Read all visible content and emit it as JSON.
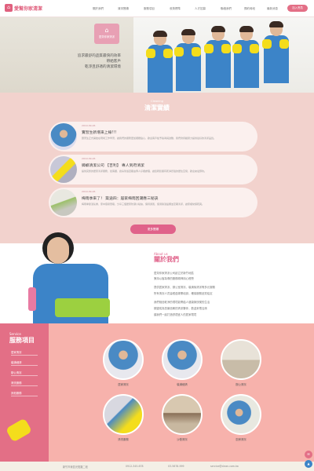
{
  "header": {
    "brand": "愛幫你家清潔",
    "nav": [
      "關於我們",
      "清潔實績",
      "服務項目",
      "收費標準",
      "人才招募",
      "聯絡我們",
      "預約時段",
      "最新消息"
    ],
    "login": "加入會員"
  },
  "hero": {
    "logo_text": "愛幫你家清潔",
    "lines": [
      "追求最舒的品質最快的效率",
      "帶給客戶",
      "乾淨且舒適的清潔環境"
    ]
  },
  "cleaning": {
    "subtitle": "Cleaning",
    "title": "清潔實績",
    "items": [
      {
        "date": "2019-09-26",
        "title": "實習生新增來上線!!!",
        "text": "實習生正式開始在現場工作學習，讓我們的服務更加細緻貼心，歡迎客戶給予指導與鼓勵，我們會持續努力提供最好的清潔品質。"
      },
      {
        "date": "2019-09-26",
        "title": "蟑螂清潔公司 【吉利】 專人到府清潔",
        "text": "提供完整的居家清潔服務，從客廳、廚房到浴室都由專人仔細處理，讓您輕鬆擁有乾淨舒適的居住空間，歡迎來電預約。"
      },
      {
        "date": "2019-09-26",
        "title": "梅雨季來了！ 築途四：居家梅雨回潮應三秘訣",
        "text": "梅雨季節濕氣重，家中容易發霉，分享三個居家防潮小秘訣，保持通風、使用除濕設備並定期清潔，讓家裡常保乾爽。"
      }
    ],
    "more": "更多實績"
  },
  "about": {
    "subtitle": "About us",
    "title": "關於我們",
    "paragraphs": [
      "愛幫你家清潔公司創立於新竹地區",
      "秉持以客為尊的服務精神用心經營",
      "提供居家清潔、辦公室清潔、裝潢後清潔等多元服務",
      "所有清潔人員皆經過專業培訓，確保服務品質穩定",
      "我們相信乾淨的環境能帶給人健康與快樂的生活",
      "期望成為您最信賴的清潔夥伴，歡迎來電洽詢",
      "讓我們一起打造舒適宜人的居家環境"
    ]
  },
  "service": {
    "subtitle": "Service",
    "title": "服務項目",
    "menu": [
      "居家清潔",
      "裝潢細清",
      "辦公清潔",
      "清洗服務",
      "其他服務"
    ],
    "items": [
      "居家清潔",
      "裝潢細清",
      "辦公清潔",
      "清洗服務",
      "沙發清潔",
      "廚房清潔"
    ]
  },
  "footer": {
    "items": [
      "新竹市東區光復路二段",
      "0912-345-678",
      "03-5678-999",
      "service@clean.com.tw"
    ]
  },
  "colors": {
    "accent": "#e36f86",
    "panel": "#f2d2cd",
    "service": "#f7b2ac"
  }
}
